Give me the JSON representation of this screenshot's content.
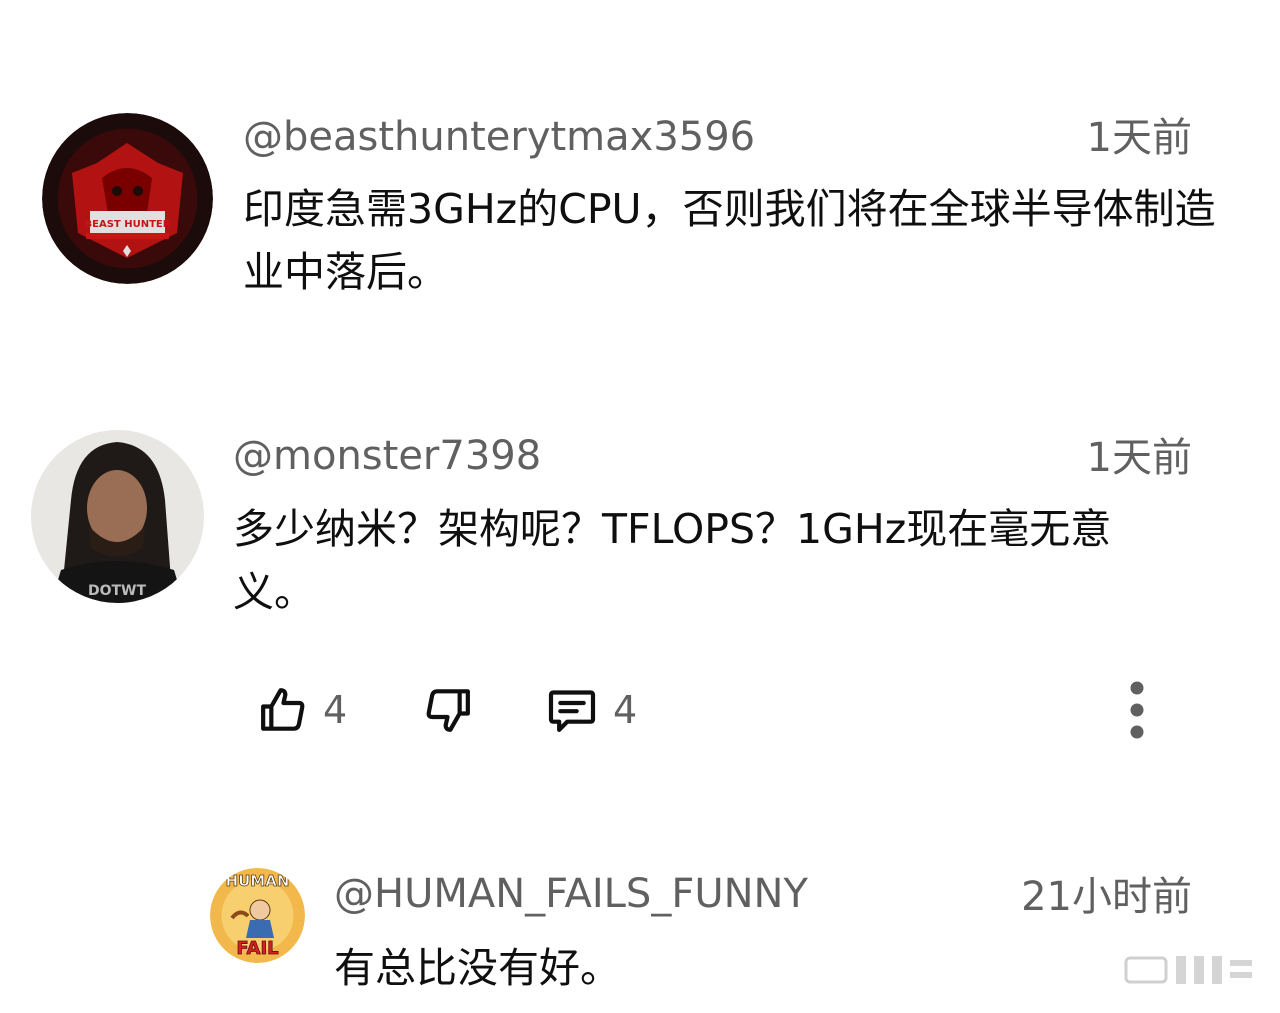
{
  "comments": [
    {
      "username": "@beasthunterytmax3596",
      "time": "1天前",
      "text": "印度急需3GHz的CPU，否则我们将在全球半导体制造业中落后。",
      "avatar_text": "BEAST HUNTER"
    },
    {
      "username": "@monster7398",
      "time": "1天前",
      "text": "多少纳米？架构呢？TFLOPS？1GHz现在毫无意义。",
      "likes": "4",
      "replies": "4"
    },
    {
      "username": "@HUMAN_FAILS_FUNNY",
      "time": "21小时前",
      "text": "有总比没有好。",
      "avatar_text_top": "HUMAN",
      "avatar_text_bottom": "FAIL"
    }
  ],
  "colors": {
    "text": "#0f0f0f",
    "secondary": "#606060",
    "avatar1_bg": "#1b0b0b",
    "avatar1_accent": "#c81414",
    "avatar3_bg": "#f2b84b"
  },
  "icons": [
    "thumbs-up-icon",
    "thumbs-down-icon",
    "reply-icon",
    "more-vert-icon"
  ]
}
